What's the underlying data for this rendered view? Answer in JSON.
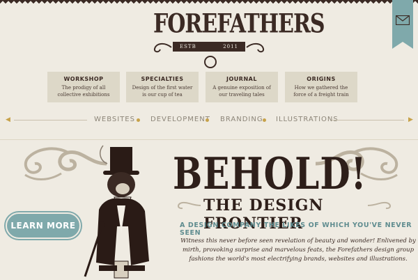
{
  "header": {
    "logo_text": "FOREFATHERS",
    "estd": "ESTB",
    "year": "2011",
    "mail_icon": "envelope-icon"
  },
  "nav": [
    {
      "title": "WORKSHOP",
      "desc": "The prodigy of all collective exhibitions"
    },
    {
      "title": "SPECIALTIES",
      "desc": "Design of the first water is our cup of tea"
    },
    {
      "title": "JOURNAL",
      "desc": "A genuine exposition of our traveling tales"
    },
    {
      "title": "ORIGINS",
      "desc": "How we gathered the force of a freight train"
    }
  ],
  "subnav": [
    "WEBSITES",
    "DEVELOPMENT",
    "BRANDING",
    "ILLUSTRATIONS"
  ],
  "hero": {
    "headline": "BEHOLD!",
    "subheadline": "THE DESIGN FRONTIER",
    "tagline": "A DESIGN COMPANY THE LIKES OF WHICH YOU'VE NEVER SEEN",
    "body": "Witness this never before seen revelation of beauty and wonder! Enlivened by mirth, provoking surprise and marvelous feats, the Forefathers design group fashions the world's most electrifying brands, websites and illustrations.",
    "cta": "LEARN MORE"
  },
  "colors": {
    "background": "#efebe2",
    "ink": "#3b2a24",
    "teal": "#7fa9ab",
    "gold": "#c7a24a"
  }
}
